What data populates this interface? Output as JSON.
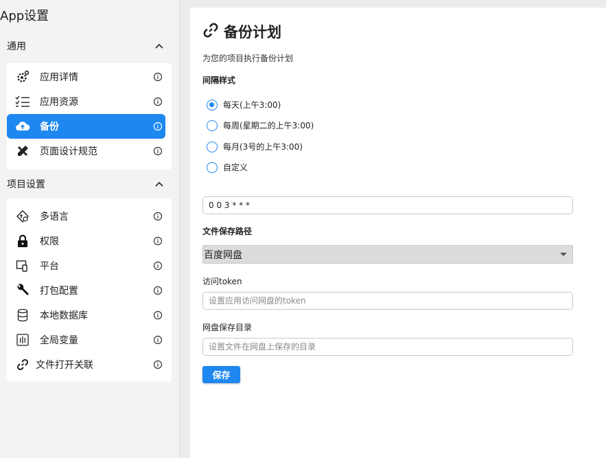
{
  "app_title": "App设置",
  "sidebar": {
    "groups": [
      {
        "title": "通用",
        "items": [
          {
            "label": "应用详情",
            "icon": "gear-cog-icon"
          },
          {
            "label": "应用资源",
            "icon": "checklist-icon"
          },
          {
            "label": "备份",
            "icon": "cloud-upload-icon",
            "active": true
          },
          {
            "label": "页面设计规范",
            "icon": "ruler-pencil-icon"
          }
        ]
      },
      {
        "title": "项目设置",
        "items": [
          {
            "label": "多语言",
            "icon": "translate-icon"
          },
          {
            "label": "权限",
            "icon": "lock-icon"
          },
          {
            "label": "平台",
            "icon": "devices-icon"
          },
          {
            "label": "打包配置",
            "icon": "wrench-icon"
          },
          {
            "label": "本地数据库",
            "icon": "database-icon"
          },
          {
            "label": "全局变量",
            "icon": "variable-icon"
          },
          {
            "label": "文件打开关联",
            "icon": "link-icon"
          }
        ]
      }
    ]
  },
  "main": {
    "title": "备份计划",
    "description": "为您的项目执行备份计划",
    "interval_label": "间隔样式",
    "options": [
      {
        "label": "每天(上午3:00)",
        "selected": true
      },
      {
        "label": "每周(星期二的上午3:00)",
        "selected": false
      },
      {
        "label": "每月(3号的上午3:00)",
        "selected": false
      },
      {
        "label": "自定义",
        "selected": false
      }
    ],
    "cron_value": "0 0 3 * * *",
    "path_label": "文件保存路径",
    "path_selected": "百度网盘",
    "token_label": "访问token",
    "token_placeholder": "设置应用访问网盘的token",
    "dir_label": "网盘保存目录",
    "dir_placeholder": "设置文件在网盘上保存的目录",
    "save_label": "保存"
  },
  "colors": {
    "accent": "#1e88f0",
    "sidebar_bg": "#f3f3f3"
  }
}
